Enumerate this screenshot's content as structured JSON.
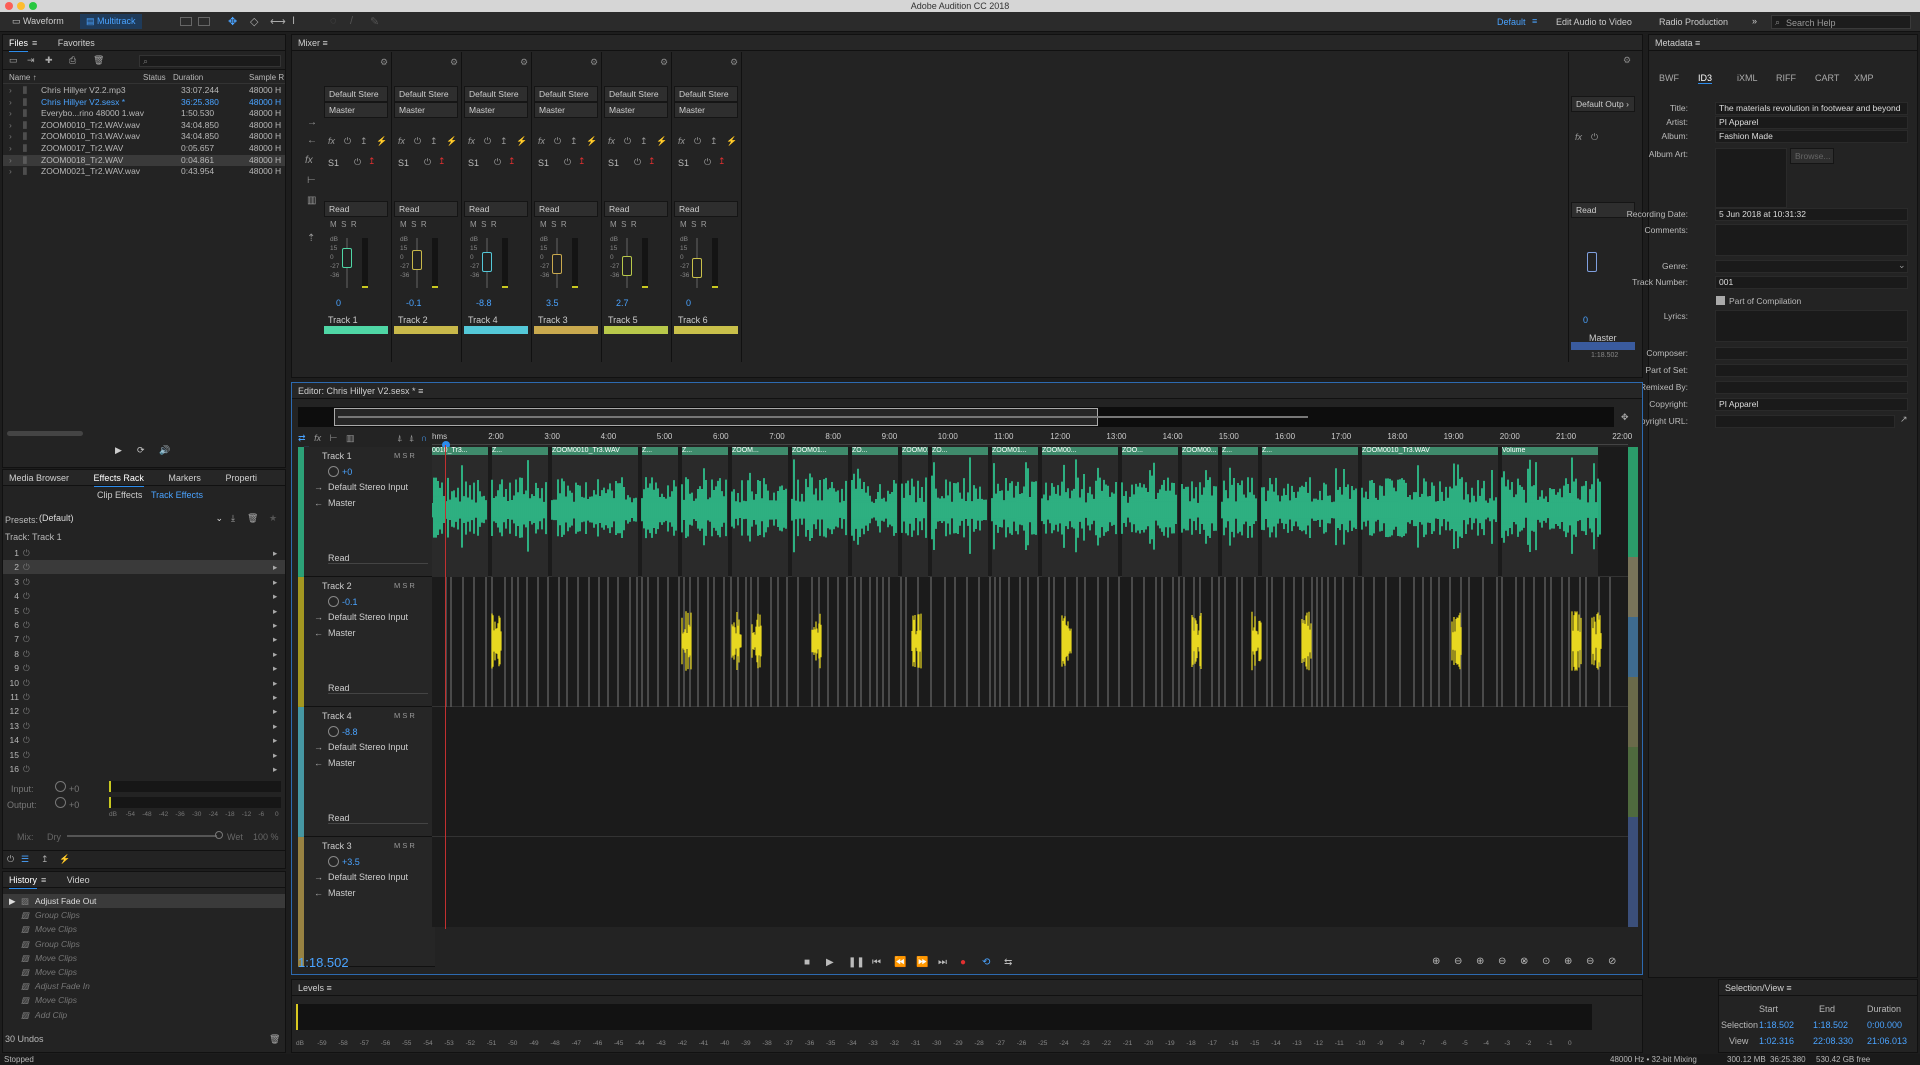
{
  "app_title": "Adobe Audition CC 2018",
  "toolbar": {
    "waveform_label": "Waveform",
    "multitrack_label": "Multitrack",
    "workspaces": [
      "Default",
      "Edit Audio to Video",
      "Radio Production"
    ],
    "search_placeholder": "Search Help"
  },
  "files_panel": {
    "tabs": [
      "Files",
      "Favorites"
    ],
    "columns": [
      "Name ↑",
      "Status",
      "Duration",
      "Sample R"
    ],
    "rows": [
      {
        "name": "Chris Hillyer V2.2.mp3",
        "duration": "33:07.244",
        "rate": "48000 H"
      },
      {
        "name": "Chris Hillyer V2.sesx *",
        "duration": "36:25.380",
        "rate": "48000 H"
      },
      {
        "name": "Everybo...rino 48000 1.wav",
        "duration": "1:50.530",
        "rate": "48000 H"
      },
      {
        "name": "ZOOM0010_Tr2.WAV.wav",
        "duration": "34:04.850",
        "rate": "48000 H"
      },
      {
        "name": "ZOOM0010_Tr3.WAV.wav",
        "duration": "34:04.850",
        "rate": "48000 H"
      },
      {
        "name": "ZOOM0017_Tr2.WAV",
        "duration": "0:05.657",
        "rate": "48000 H"
      },
      {
        "name": "ZOOM0018_Tr2.WAV",
        "duration": "0:04.861",
        "rate": "48000 H"
      },
      {
        "name": "ZOOM0021_Tr2.WAV.wav",
        "duration": "0:43.954",
        "rate": "48000 H"
      }
    ]
  },
  "effects_panel": {
    "tabs": [
      "Media Browser",
      "Effects Rack",
      "Markers",
      "Properti"
    ],
    "subtabs": [
      "Clip Effects",
      "Track Effects"
    ],
    "presets_label": "Presets:",
    "presets_value": "(Default)",
    "track_label": "Track: Track 1",
    "slots": [
      "1",
      "2",
      "3",
      "4",
      "5",
      "6",
      "7",
      "8",
      "9",
      "10",
      "11",
      "12",
      "13",
      "14",
      "15",
      "16"
    ],
    "input_label": "Input:",
    "output_label": "Output:",
    "input_val": "+0",
    "output_val": "+0",
    "db_scale": [
      "dB",
      "-54",
      "-48",
      "-42",
      "-36",
      "-30",
      "-24",
      "-18",
      "-12",
      "-6",
      "0"
    ],
    "mix_label": "Mix:",
    "dry_label": "Dry",
    "wet_label": "Wet",
    "wet_pct": "100 %"
  },
  "history_panel": {
    "tabs": [
      "History",
      "Video"
    ],
    "items": [
      "Adjust Fade Out",
      "Group Clips",
      "Move Clips",
      "Group Clips",
      "Move Clips",
      "Move Clips",
      "Adjust Fade In",
      "Move Clips",
      "Add Clip"
    ],
    "undos": "30 Undos"
  },
  "mixer": {
    "title": "Mixer",
    "input_label": "Default Stere",
    "output_label": "Master",
    "slot_label": "S1",
    "read_label": "Read",
    "tracks": [
      {
        "name": "Track 1",
        "value": "0",
        "color": "#4fd6a5"
      },
      {
        "name": "Track 2",
        "value": "-0.1",
        "color": "#c8b84a"
      },
      {
        "name": "Track 4",
        "value": "-8.8",
        "color": "#54c8d8"
      },
      {
        "name": "Track 3",
        "value": "3.5",
        "color": "#c9a94e"
      },
      {
        "name": "Track 5",
        "value": "2.7",
        "color": "#b8c84a"
      },
      {
        "name": "Track 6",
        "value": "0",
        "color": "#c9c04a"
      }
    ],
    "master": {
      "output": "Default Outp",
      "name": "Master",
      "value": "0",
      "time": "1:18.502"
    },
    "db_marks": [
      "dB",
      "15",
      "0",
      "-27",
      "-36"
    ]
  },
  "editor": {
    "title": "Editor: Chris Hillyer V2.sesx *",
    "time_display": "1:18.502",
    "ruler": [
      "hms",
      "2:00",
      "3:00",
      "4:00",
      "5:00",
      "6:00",
      "7:00",
      "8:00",
      "9:00",
      "10:00",
      "11:00",
      "12:00",
      "13:00",
      "14:00",
      "15:00",
      "16:00",
      "17:00",
      "18:00",
      "19:00",
      "20:00",
      "21:00",
      "22:00"
    ],
    "tracks": [
      {
        "name": "Track 1",
        "vol": "+0",
        "input": "Default Stereo Input",
        "output": "Master",
        "mode": "Read",
        "color": "#2fd69a"
      },
      {
        "name": "Track 2",
        "vol": "-0.1",
        "input": "Default Stereo Input",
        "output": "Master",
        "mode": "Read",
        "color": "#d8c820"
      },
      {
        "name": "Track 4",
        "vol": "-8.8",
        "input": "Default Stereo Input",
        "output": "Master",
        "mode": "Read",
        "color": "#54c8d8"
      },
      {
        "name": "Track 3",
        "vol": "+3.5",
        "input": "Default Stereo Input",
        "output": "Master",
        "mode": "Read",
        "color": "#c9a94e"
      }
    ],
    "clip_labels": [
      "0010_Tr3...",
      "Z...",
      "ZOOM0010_Tr3.WAV",
      "Z...",
      "Z...",
      "ZOOM...",
      "ZOOM01...",
      "ZO...",
      "ZOOM01...",
      "ZO...",
      "ZOOM01...",
      "ZOOM00...",
      "ZOO...",
      "ZOOM00...",
      "Z...",
      "Z...",
      "ZOOM0010_Tr3.WAV",
      "Volume"
    ]
  },
  "metadata": {
    "title": "Metadata",
    "tabs": [
      "BWF",
      "ID3",
      "iXML",
      "RIFF",
      "CART",
      "XMP"
    ],
    "fields": {
      "title_label": "Title:",
      "title": "The materials revolution in footwear and beyond",
      "artist_label": "Artist:",
      "artist": "PI Apparel",
      "album_label": "Album:",
      "album": "Fashion Made",
      "album_art_label": "Album Art:",
      "browse": "Browse...",
      "recording_label": "Recording Date:",
      "recording": "5 Jun 2018 at 10:31:32",
      "comments_label": "Comments:",
      "genre_label": "Genre:",
      "track_label": "Track Number:",
      "track": "001",
      "compilation": "Part of Compilation",
      "lyrics_label": "Lyrics:",
      "composer_label": "Composer:",
      "partset_label": "Part of Set:",
      "remixed_label": "Remixed By:",
      "copyright_label": "Copyright:",
      "copyright": "PI Apparel",
      "copyurl_label": "Copyright URL:"
    }
  },
  "levels": {
    "title": "Levels",
    "scale": [
      "dB",
      "-59",
      "-58",
      "-57",
      "-56",
      "-55",
      "-54",
      "-53",
      "-52",
      "-51",
      "-50",
      "-49",
      "-48",
      "-47",
      "-46",
      "-45",
      "-44",
      "-43",
      "-42",
      "-41",
      "-40",
      "-39",
      "-38",
      "-37",
      "-36",
      "-35",
      "-34",
      "-33",
      "-32",
      "-31",
      "-30",
      "-29",
      "-28",
      "-27",
      "-26",
      "-25",
      "-24",
      "-23",
      "-22",
      "-21",
      "-20",
      "-19",
      "-18",
      "-17",
      "-16",
      "-15",
      "-14",
      "-13",
      "-12",
      "-11",
      "-10",
      "-9",
      "-8",
      "-7",
      "-6",
      "-5",
      "-4",
      "-3",
      "-2",
      "-1",
      "0"
    ]
  },
  "selection_view": {
    "title": "Selection/View",
    "headers": [
      "Start",
      "End",
      "Duration"
    ],
    "selection_label": "Selection",
    "view_label": "View",
    "selection": [
      "1:18.502",
      "1:18.502",
      "0:00.000"
    ],
    "view": [
      "1:02.316",
      "22:08.330",
      "21:06.013"
    ]
  },
  "status_bar": {
    "left": "Stopped",
    "items": [
      "48000 Hz • 32-bit Mixing",
      "300.12 MB",
      "36:25.380",
      "530.42 GB free"
    ]
  }
}
